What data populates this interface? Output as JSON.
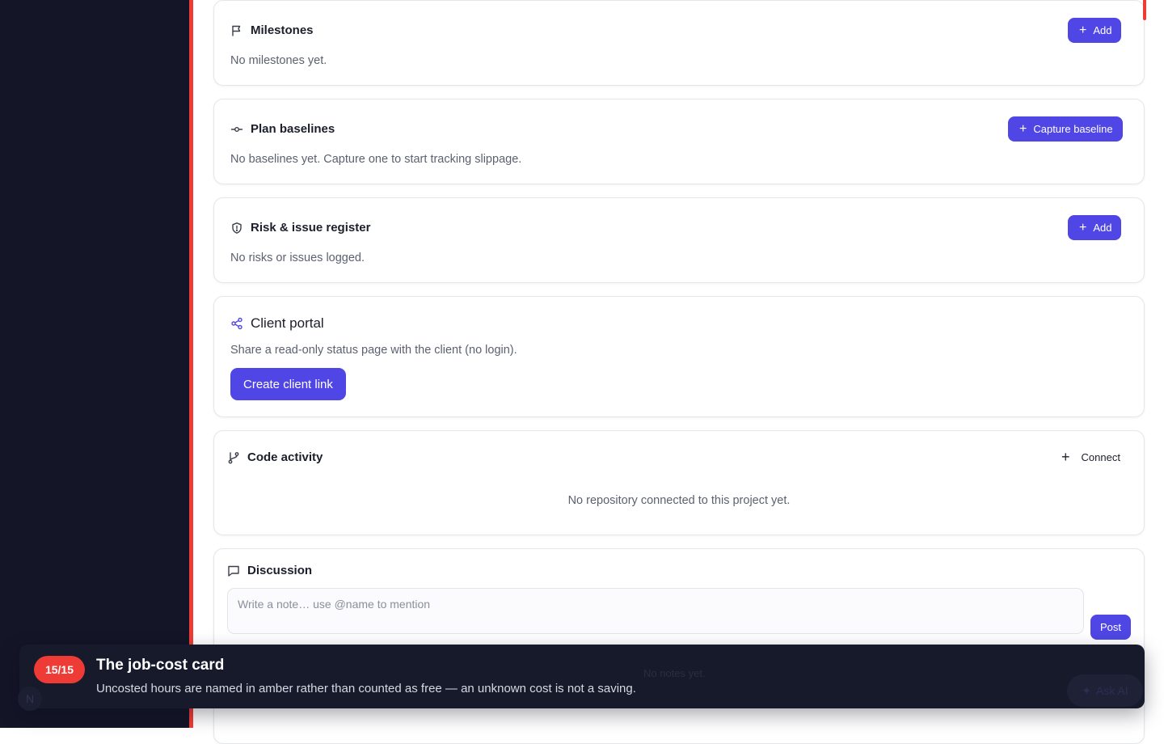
{
  "milestones": {
    "title": "Milestones",
    "add_label": "Add",
    "empty_text": "No milestones yet."
  },
  "baselines": {
    "title": "Plan baselines",
    "button_label": "Capture baseline",
    "empty_text": "No baselines yet. Capture one to start tracking slippage."
  },
  "risks": {
    "title": "Risk & issue register",
    "add_label": "Add",
    "empty_text": "No risks or issues logged."
  },
  "client_portal": {
    "title": "Client portal",
    "description": "Share a read-only status page with the client (no login).",
    "button_label": "Create client link"
  },
  "code_activity": {
    "title": "Code activity",
    "connect_label": "Connect",
    "empty_text": "No repository connected to this project yet."
  },
  "discussion": {
    "title": "Discussion",
    "placeholder": "Write a note… use @name to mention",
    "post_label": "Post",
    "empty_text": "No notes yet."
  },
  "tour": {
    "step": "15/15",
    "title": "The job-cost card",
    "body": "Uncosted hours are named in amber rather than counted as free — an unknown cost is not a saving."
  },
  "ask_ai": {
    "label": "Ask AI"
  },
  "avatar": {
    "initial": "N"
  },
  "colors": {
    "accent": "#4f46e5",
    "sidebar": "#141628",
    "tour_badge": "#ef3b35",
    "tour_bg": "#161a2b"
  }
}
